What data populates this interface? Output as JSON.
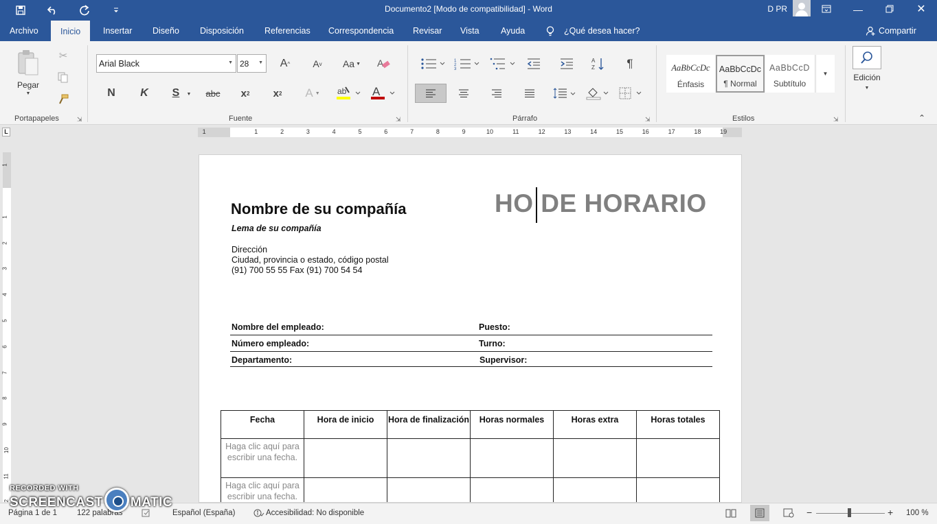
{
  "titlebar": {
    "title": "Documento2 [Modo de compatibilidad]  -  Word",
    "user": "D PR",
    "save_icon": "save-icon",
    "undo_icon": "undo-icon",
    "redo_icon": "redo-icon"
  },
  "tabs": [
    "Archivo",
    "Inicio",
    "Insertar",
    "Diseño",
    "Disposición",
    "Referencias",
    "Correspondencia",
    "Revisar",
    "Vista",
    "Ayuda"
  ],
  "tell_me": "¿Qué desea hacer?",
  "share": "Compartir",
  "ribbon": {
    "clipboard": {
      "paste_label": "Pegar",
      "group_label": "Portapapeles"
    },
    "font": {
      "name": "Arial Black",
      "size": "28",
      "group_label": "Fuente",
      "bold": "N",
      "italic": "K",
      "underline": "S",
      "strike": "abc"
    },
    "paragraph": {
      "group_label": "Párrafo"
    },
    "styles": {
      "group_label": "Estilos",
      "items": [
        {
          "preview": "AaBbCcDc",
          "name": "Énfasis"
        },
        {
          "preview": "AaBbCcDc",
          "name": "¶ Normal"
        },
        {
          "preview": "AaBbCcD",
          "name": "Subtítulo"
        }
      ]
    },
    "editing": {
      "label": "Edición"
    }
  },
  "document": {
    "company_name": "Nombre de su compañía",
    "motto": "Lema de su compañía",
    "address_line1": "Dirección",
    "address_line2": "Ciudad, provincia o estado, código postal",
    "address_line3": "(91) 700 55 55  Fax (91) 700 54 54",
    "title": "HO DE HORARIO",
    "fields": {
      "employee_name": "Nombre del empleado:",
      "position": "Puesto:",
      "employee_number": "Número empleado:",
      "shift": "Turno:",
      "department": "Departamento:",
      "supervisor": "Supervisor:"
    },
    "table": {
      "headers": [
        "Fecha",
        "Hora de inicio",
        "Hora de finalización",
        "Horas normales",
        "Horas extra",
        "Horas totales"
      ],
      "date_placeholder": "Haga clic aquí para escribir una fecha."
    }
  },
  "ruler": {
    "h_marks": [
      "1",
      "1",
      "2",
      "3",
      "4",
      "5",
      "6",
      "7",
      "8",
      "9",
      "10",
      "11",
      "12",
      "13",
      "14",
      "15",
      "16",
      "17",
      "18",
      "19"
    ],
    "v_marks": [
      "1",
      "1",
      "2",
      "3",
      "4",
      "5",
      "6",
      "7",
      "8",
      "9",
      "10",
      "11",
      "12"
    ]
  },
  "status": {
    "page": "Página 1 de 1",
    "words": "122 palabras",
    "language": "Español (España)",
    "accessibility": "Accesibilidad: No disponible",
    "zoom": "100 %"
  },
  "watermark": {
    "line1": "RECORDED WITH",
    "line2a": "SCREENCAST",
    "line2b": "MATIC"
  }
}
